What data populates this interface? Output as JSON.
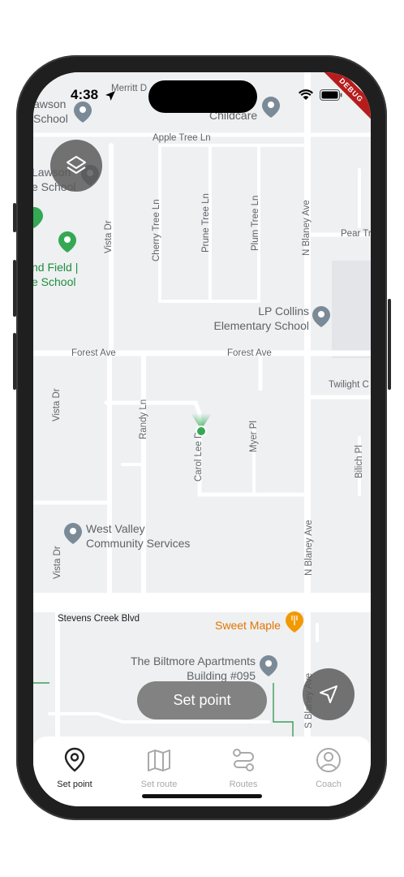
{
  "status_bar": {
    "time": "4:38"
  },
  "debug_banner": "DEBUG",
  "map": {
    "pois": [
      {
        "id": "lawson-school-top",
        "lines": [
          "awson",
          "School"
        ],
        "style": "gray"
      },
      {
        "id": "childcare",
        "lines": [
          "Childcare"
        ],
        "style": "gray"
      },
      {
        "id": "lawson-school-left",
        "lines": [
          "Lawson",
          "e School"
        ],
        "style": "gray"
      },
      {
        "id": "field-school",
        "lines": [
          "nd Field |",
          "e School"
        ],
        "style": "green"
      },
      {
        "id": "lp-collins",
        "lines": [
          "LP Collins",
          "Elementary School"
        ],
        "style": "gray"
      },
      {
        "id": "west-valley",
        "lines": [
          "West Valley",
          "Community Services"
        ],
        "style": "gray"
      },
      {
        "id": "sweet-maple",
        "lines": [
          "Sweet Maple"
        ],
        "style": "orange"
      },
      {
        "id": "biltmore",
        "lines": [
          "The Biltmore Apartments",
          "Building #095"
        ],
        "style": "gray"
      }
    ],
    "roads": {
      "merritt": "Merritt D",
      "apple_tree": "Apple Tree Ln",
      "vista_dr_top": "Vista Dr",
      "cherry_tree": "Cherry Tree Ln",
      "prune_tree": "Prune Tree Ln",
      "plum_tree": "Plum Tree Ln",
      "n_blaney_top": "N Blaney Ave",
      "pear_tree": "Pear Tr",
      "forest_ave_left": "Forest Ave",
      "forest_ave_right": "Forest Ave",
      "twilight": "Twilight C",
      "vista_dr_mid": "Vista Dr",
      "randy": "Randy Ln",
      "carol_lee": "Carol Lee D",
      "myer": "Myer Pl",
      "bilich": "Bilich Pl",
      "n_blaney_mid": "N Blaney Ave",
      "vista_dr_low": "Vista Dr",
      "stevens_creek": "Stevens Creek Blvd",
      "s_blaney": "S Blaney Ave"
    }
  },
  "set_point_label": "Set point",
  "nav": [
    {
      "id": "set-point",
      "label": "Set point",
      "icon": "map-pin-icon",
      "active": true
    },
    {
      "id": "set-route",
      "label": "Set route",
      "icon": "map-icon",
      "active": false
    },
    {
      "id": "routes",
      "label": "Routes",
      "icon": "routes-icon",
      "active": false
    },
    {
      "id": "coach",
      "label": "Coach",
      "icon": "user-circle-icon",
      "active": false
    }
  ],
  "colors": {
    "accent_green": "#34a853",
    "map_bg": "#eef0f2",
    "road": "#ffffff"
  }
}
